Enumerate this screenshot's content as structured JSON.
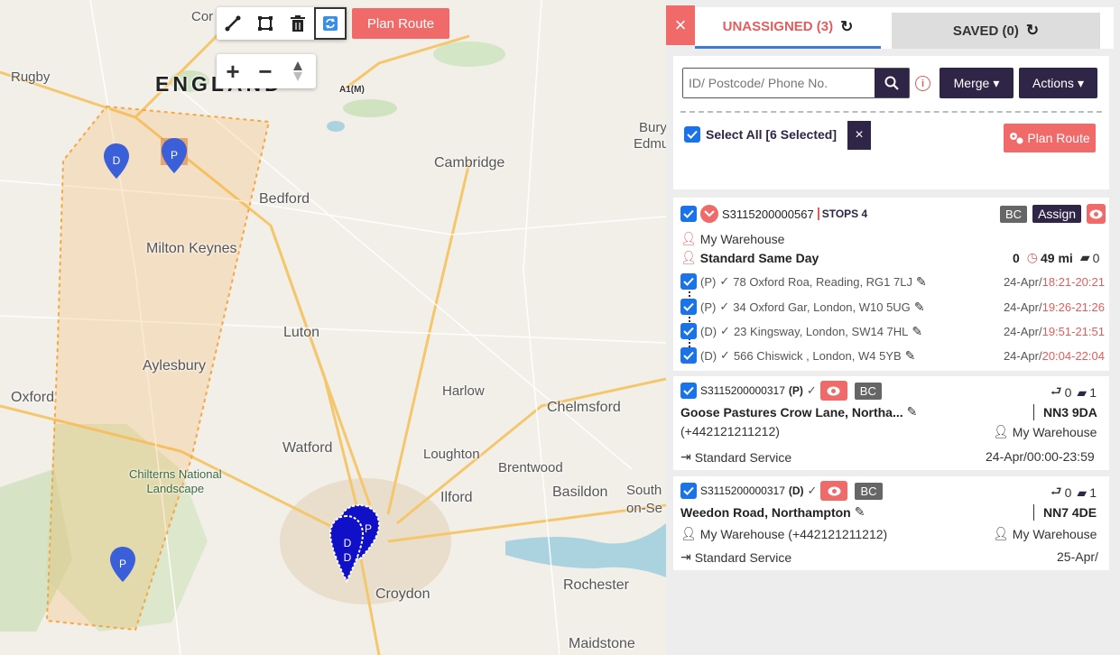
{
  "map": {
    "toolbar": {
      "tools": [
        "line-draw-icon",
        "polygon-draw-icon",
        "trash-icon",
        "refresh-icon"
      ],
      "plan_route_label": "Plan Route"
    },
    "zoom": {
      "in": "+",
      "out": "−"
    },
    "places": {
      "rugby": "Rugby",
      "cor": "Cor",
      "england": "ENGLAND",
      "a1m": "A1(M)",
      "bedford": "Bedford",
      "cambridge": "Cambridge",
      "bury": "Bury",
      "edmu": "Edmu",
      "milton_keynes": "Milton Keynes",
      "luton": "Luton",
      "aylesbury": "Aylesbury",
      "oxford": "Oxford",
      "harlow": "Harlow",
      "chelmsford": "Chelmsford",
      "watford": "Watford",
      "loughton": "Loughton",
      "brentwood": "Brentwood",
      "chilterns": "Chilterns National",
      "landscape": "Landscape",
      "ilford": "Ilford",
      "basildon": "Basildon",
      "south": "South",
      "on_sea": "on-Se",
      "croydon": "Croydon",
      "rochester": "Rochester",
      "maidstone": "Maidstone"
    },
    "markers": {
      "d": "D",
      "p": "P"
    },
    "colors": {
      "marker": "#3b5fd9",
      "marker_dark": "#1010c8",
      "area": "#f5a742"
    }
  },
  "panel": {
    "close_label": "×",
    "tabs": {
      "unassigned": "UNASSIGNED (3)",
      "saved": "SAVED (0)"
    },
    "search": {
      "placeholder": "ID/ Postcode/ Phone No."
    },
    "merge_label": "Merge",
    "actions_label": "Actions",
    "select_all_label": "Select All [6 Selected]",
    "clear_label": "×",
    "plan_route_label": "Plan Route",
    "colors": {
      "accent": "#f06a6a",
      "navy": "#2f2546",
      "check": "#1a73e8"
    }
  },
  "cards": {
    "c1": {
      "id": "S3115200000567",
      "stops": "STOPS 4",
      "bc": "BC",
      "assign": "Assign",
      "warehouse": "My Warehouse",
      "service": "Standard Same Day",
      "count": "0",
      "distance": "49 mi",
      "parcels": "0",
      "stops_list": [
        {
          "type": "(P)",
          "address": "78 Oxford Roa, Reading, RG1 7LJ",
          "date": "24-Apr/",
          "time": "18:21-20:21"
        },
        {
          "type": "(P)",
          "address": "34 Oxford Gar, London, W10 5UG",
          "date": "24-Apr/",
          "time": "19:26-21:26"
        },
        {
          "type": "(D)",
          "address": "23 Kingsway, London, SW14 7HL",
          "date": "24-Apr/",
          "time": "19:51-21:51"
        },
        {
          "type": "(D)",
          "address": "566 Chiswick , London, W4 5YB",
          "date": "24-Apr/",
          "time": "20:04-22:04"
        }
      ]
    },
    "c2": {
      "id": "S3115200000317",
      "type": "(P)",
      "bc": "BC",
      "returns": "0",
      "parcels": "1",
      "address": "Goose Pastures Crow Lane, Northa...",
      "postcode": "NN3 9DA",
      "phone": "(+442121211212)",
      "warehouse": "My Warehouse",
      "service": "Standard Service",
      "window": "24-Apr/00:00-23:59"
    },
    "c3": {
      "id": "S3115200000317",
      "type": "(D)",
      "bc": "BC",
      "returns": "0",
      "parcels": "1",
      "address": "Weedon Road, Northampton",
      "postcode": "NN7 4DE",
      "contact": "My Warehouse (+442121211212)",
      "warehouse": "My Warehouse",
      "service": "Standard Service",
      "window": "25-Apr/"
    }
  }
}
